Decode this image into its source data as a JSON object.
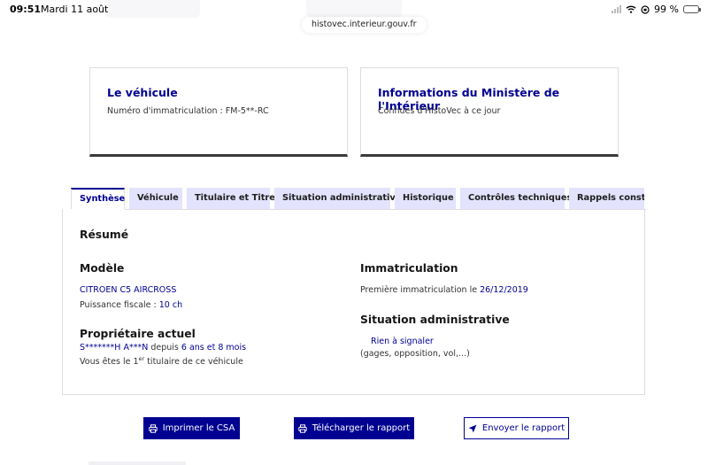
{
  "status_bar": {
    "time": "09:51",
    "date": "Mardi 11 août",
    "battery": "99 %"
  },
  "browser": {
    "url": "histovec.interieur.gouv.fr"
  },
  "cards": [
    {
      "title": "Le véhicule",
      "text": "Numéro d'immatriculation : FM-5**-RC"
    },
    {
      "title": "Informations du Ministère de l'Intérieur",
      "text": "Connues d'HistoVec à ce jour"
    }
  ],
  "tabs": [
    {
      "label": "Synthèse",
      "active": true
    },
    {
      "label": "Véhicule"
    },
    {
      "label": "Titulaire et Titre"
    },
    {
      "label": "Situation administrative"
    },
    {
      "label": "Historique"
    },
    {
      "label": "Contrôles techniques"
    },
    {
      "label": "Rappels constructeur"
    }
  ],
  "summary": {
    "heading": "Résumé",
    "modele": {
      "title": "Modèle",
      "name": "CITROEN C5 AIRCROSS",
      "puissance_label": "Puissance fiscale :",
      "puissance_value": "10 ch"
    },
    "proprietaire": {
      "title": "Propriétaire actuel",
      "name": "S*******H A***N",
      "depuis": "depuis",
      "duration": "6 ans et 8 mois",
      "rank_prefix": "Vous êtes le 1",
      "rank_sup": "er",
      "rank_suffix": "titulaire de ce véhicule"
    },
    "immatriculation": {
      "title": "Immatriculation",
      "label": "Première immatriculation le",
      "date": "26/12/2019"
    },
    "situation": {
      "title": "Situation administrative",
      "status": "Rien à signaler",
      "detail": "(gages, opposition, vol,...)"
    }
  },
  "actions": {
    "print": "Imprimer le CSA",
    "download": "Télécharger le rapport",
    "send": "Envoyer le rapport"
  },
  "colors": {
    "primary": "#000091",
    "tab_bg": "#e3e3fd",
    "border": "#dddde2"
  }
}
